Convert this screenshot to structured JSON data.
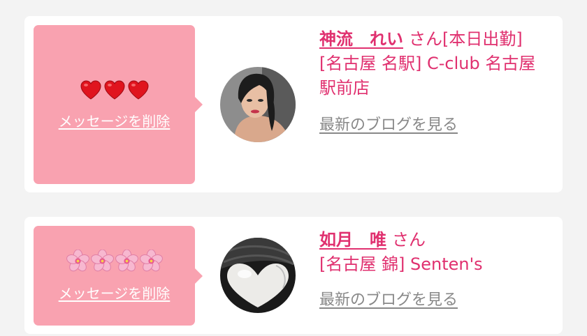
{
  "entries": [
    {
      "message_emoji": "heart-icon x3",
      "delete_label": "メッセージを削除",
      "name": "神流　れい",
      "honorific": "さん",
      "status": "[本日出勤]",
      "shop": "[名古屋 名駅] C-club 名古屋駅前店",
      "blog_label": "最新のブログを見る"
    },
    {
      "message_emoji": "cherry-blossom-icon x4",
      "delete_label": "メッセージを削除",
      "name": "如月　唯",
      "honorific": "さん",
      "status": "",
      "shop": "[名古屋 錦] Senten's",
      "blog_label": "最新のブログを見る"
    }
  ],
  "colors": {
    "page_background": "#f3f3f3",
    "card_background": "#ffffff",
    "message_box": "#f9a2b0",
    "name_text": "#e0306f",
    "blog_link": "#888888"
  }
}
